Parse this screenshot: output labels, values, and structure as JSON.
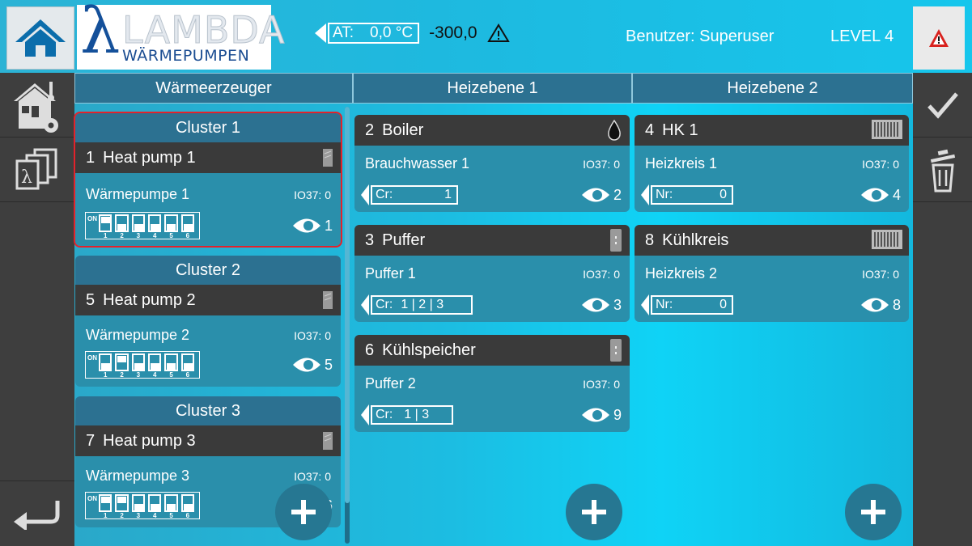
{
  "header": {
    "logo_main": "LAMBDA",
    "logo_sub": "WÄRMEPUMPEN",
    "at_label": "AT:",
    "at_value": "0,0 °C",
    "at_reading": "-300,0",
    "user": "Benutzer: Superuser",
    "level": "LEVEL 4",
    "icons": {
      "home": "home-icon",
      "alert": "alert-icon",
      "warning": "warning-icon"
    }
  },
  "columns": [
    {
      "label": "Wärmeerzeuger"
    },
    {
      "label": "Heizebene 1"
    },
    {
      "label": "Heizebene 2"
    }
  ],
  "clusters": [
    {
      "title": "Cluster 1",
      "selected": true,
      "device": {
        "num": "1",
        "name": "Heat pump 1",
        "sub": "Wärmepumpe 1",
        "code": "IO37: 0",
        "view": "1"
      },
      "dip_on": [
        true,
        false,
        false,
        false,
        false,
        false
      ]
    },
    {
      "title": "Cluster 2",
      "selected": false,
      "device": {
        "num": "5",
        "name": "Heat pump 2",
        "sub": "Wärmepumpe 2",
        "code": "IO37: 0",
        "view": "5"
      },
      "dip_on": [
        false,
        true,
        false,
        false,
        false,
        false
      ]
    },
    {
      "title": "Cluster 3",
      "selected": false,
      "device": {
        "num": "7",
        "name": "Heat pump 3",
        "sub": "Wärmepumpe 3",
        "code": "IO37: 0",
        "view": "6"
      },
      "dip_on": [
        true,
        true,
        false,
        false,
        false,
        false
      ]
    }
  ],
  "dip": {
    "on_label": "ON",
    "numbers": [
      "1",
      "2",
      "3",
      "4",
      "5",
      "6"
    ]
  },
  "heizebene1": [
    {
      "num": "2",
      "name": "Boiler",
      "sub": "Brauchwasser 1",
      "code": "IO37: 0",
      "cr_label": "Cr:",
      "cr_value": "1",
      "view": "2",
      "icon": "drop-icon"
    },
    {
      "num": "3",
      "name": "Puffer",
      "sub": "Puffer 1",
      "code": "IO37: 0",
      "cr_label": "Cr:",
      "cr_value": "1 | 2 | 3",
      "view": "3",
      "icon": "tank-icon"
    },
    {
      "num": "6",
      "name": "Kühlspeicher",
      "sub": "Puffer 2",
      "code": "IO37: 0",
      "cr_label": "Cr:",
      "cr_value": "1 | 3",
      "view": "9",
      "icon": "tank-icon"
    }
  ],
  "heizebene2": [
    {
      "num": "4",
      "name": "HK 1",
      "sub": "Heizkreis 1",
      "code": "IO37: 0",
      "cr_label": "Nr:",
      "cr_value": "0",
      "view": "4",
      "icon": "radiator-icon"
    },
    {
      "num": "8",
      "name": "Kühlkreis",
      "sub": "Heizkreis 2",
      "code": "IO37: 0",
      "cr_label": "Nr:",
      "cr_value": "0",
      "view": "8",
      "icon": "radiator-icon"
    }
  ],
  "toolbar_icons": {
    "left": [
      "house-settings-icon",
      "lambda-devices-icon",
      "back-icon"
    ],
    "right": [
      "check-icon",
      "trash-icon"
    ],
    "add": "plus-icon"
  },
  "colors": {
    "selected_outline": "#e3222b",
    "card": "#2a8fab",
    "card_head": "#3a3a3a",
    "header_bar": "#2c7191"
  }
}
